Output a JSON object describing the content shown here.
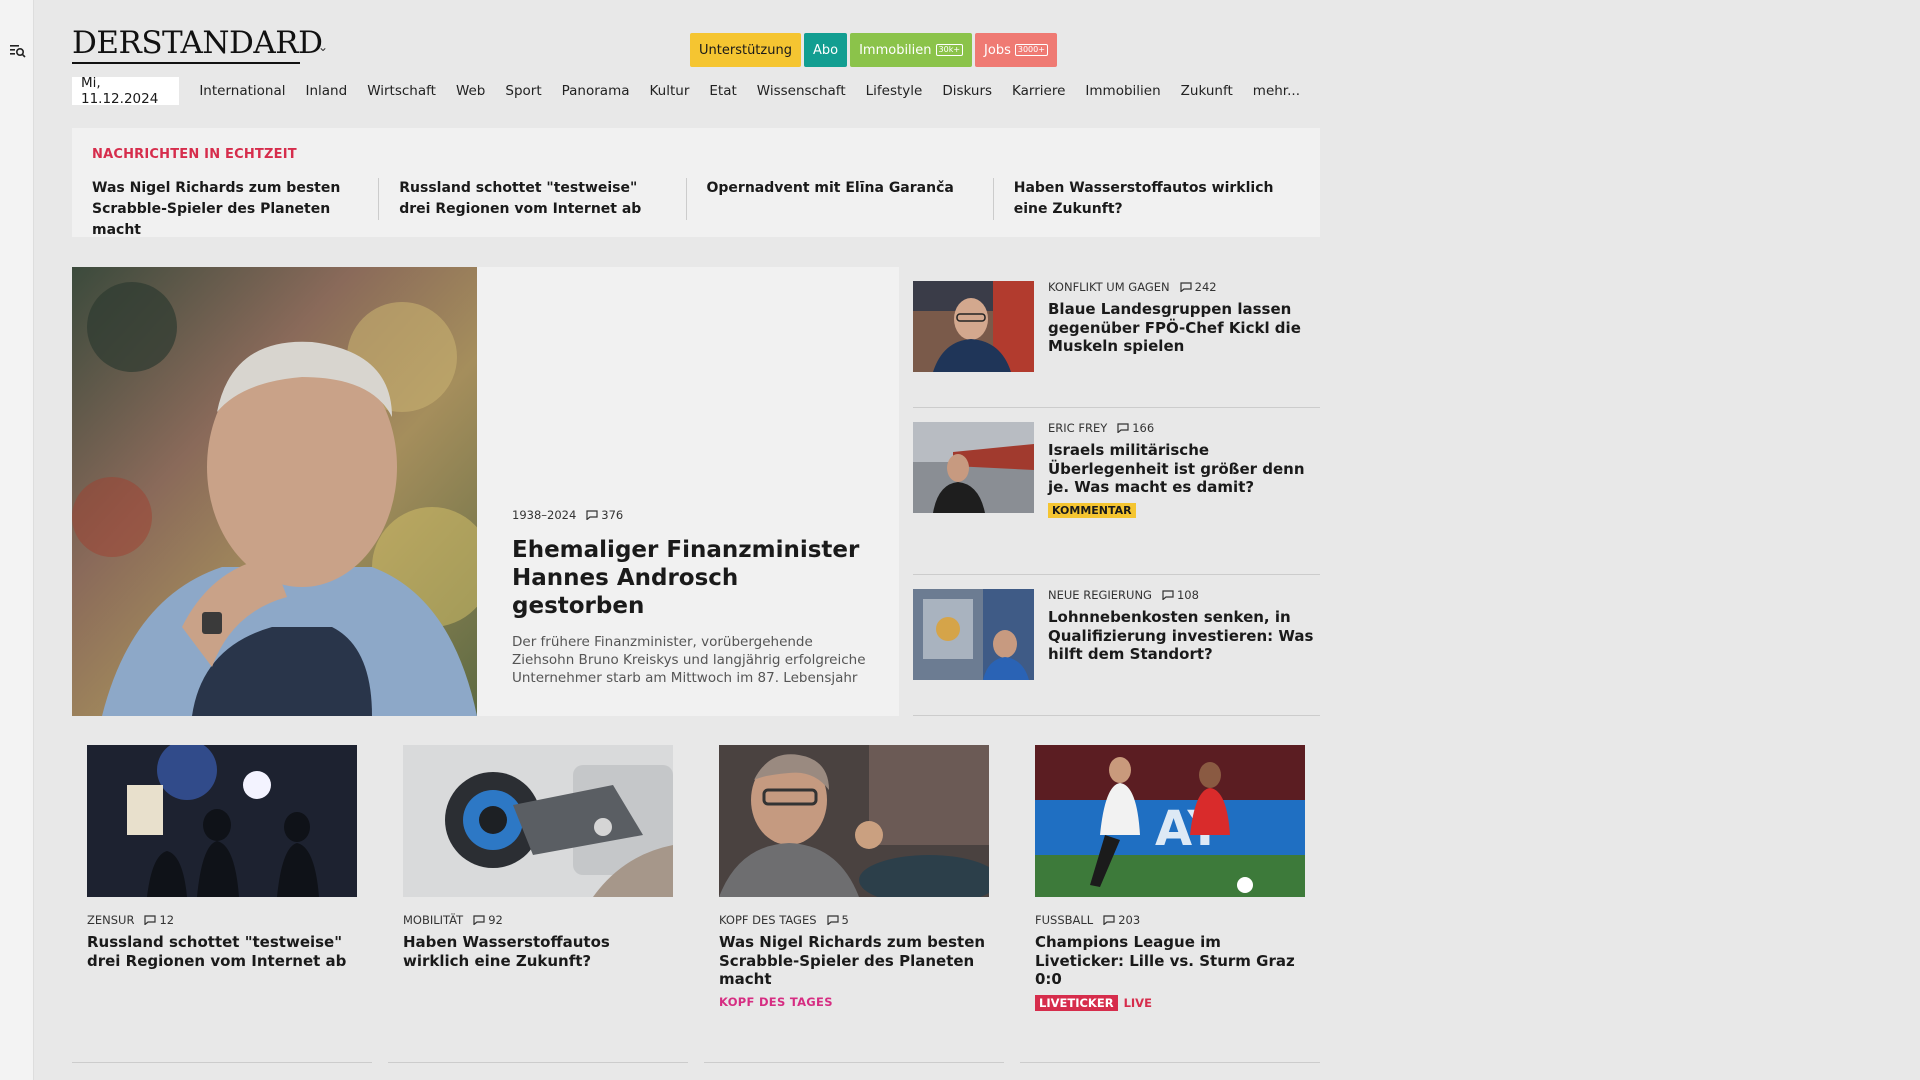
{
  "brand": {
    "logo_text": "DERSTANDARD"
  },
  "header_pills": {
    "support": "Unterstützung",
    "abo": "Abo",
    "immobilien": "Immobilien",
    "immobilien_badge": "30k+",
    "jobs": "Jobs",
    "jobs_badge": "3000+"
  },
  "nav": {
    "date": "Mi, 11.12.2024",
    "items": [
      "International",
      "Inland",
      "Wirtschaft",
      "Web",
      "Sport",
      "Panorama",
      "Kultur",
      "Etat",
      "Wissenschaft",
      "Lifestyle",
      "Diskurs",
      "Karriere",
      "Immobilien",
      "Zukunft",
      "mehr..."
    ]
  },
  "ticker": {
    "title": "NACHRICHTEN IN ECHTZEIT",
    "items": [
      "Was Nigel Richards zum besten Scrabble-Spieler des Planeten macht",
      "Russland schottet \"testweise\" drei Re­gionen vom Internet ab",
      "Opernadvent mit Elīna Garanča",
      "Haben Wasserstoffautos wirklich eine Zukunft?"
    ]
  },
  "hero": {
    "kicker": "1938–2024",
    "comments": "376",
    "title": "Ehemaliger Finanzminister Hannes Androsch gestorben",
    "subtitle": "Der frühere Finanzminister, vorübergehende Ziehsohn Bruno Kreiskys und langjährig erfolgreiche Unternehmer starb am Mittwoch im 87. Lebensjahr"
  },
  "side": [
    {
      "kicker": "KONFLIKT UM GAGEN",
      "comments": "242",
      "title": "Blaue Landesgruppen lassen gegenüber FPÖ-Chef Kickl die Muskeln spielen",
      "badge": ""
    },
    {
      "kicker": "ERIC FREY",
      "comments": "166",
      "title": "Israels militärische Überlegenheit ist größer denn je. Was macht es damit?",
      "badge": "KOMMENTAR"
    },
    {
      "kicker": "NEUE REGIERUNG",
      "comments": "108",
      "title": "Lohnnebenkosten senken, in Qualifizierung investieren: Was hilft dem Standort?",
      "badge": ""
    }
  ],
  "cards": [
    {
      "kicker": "ZENSUR",
      "comments": "12",
      "title": "Russland schottet \"testweise\" drei Regionen vom Internet ab"
    },
    {
      "kicker": "MOBILITÄT",
      "comments": "92",
      "title": "Haben Wasserstoffautos wirklich eine Zukunft?"
    },
    {
      "kicker": "KOPF DES TAGES",
      "comments": "5",
      "title": "Was Nigel Richards zum besten Scrabble-Spieler des Planeten macht",
      "tag": "KOPF DES TAGES"
    },
    {
      "kicker": "FUSSBALL",
      "comments": "203",
      "title": "Champions League im Liveticker: Lille vs. Sturm Graz 0:0",
      "live_tag": "LIVETICKER",
      "live_label": "LIVE"
    }
  ],
  "colors": {
    "accent_red": "#d62d4c",
    "support": "#f5c531",
    "abo": "#129e91",
    "immobilien": "#8bc34a",
    "jobs": "#ef7a73",
    "kopf": "#d62d82"
  }
}
